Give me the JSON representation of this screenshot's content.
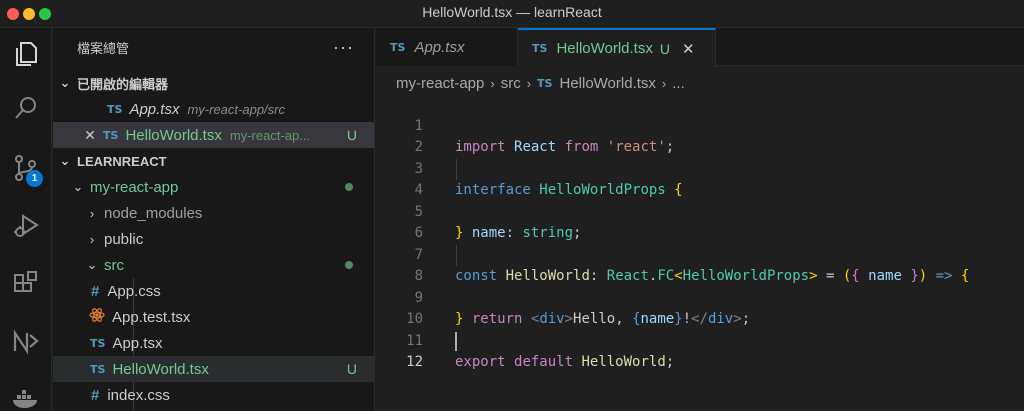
{
  "window": {
    "title": "HelloWorld.tsx — learnReact"
  },
  "activity_bar": {
    "items": [
      {
        "name": "explorer-icon"
      },
      {
        "name": "search-icon"
      },
      {
        "name": "source-control-icon",
        "badge": "1"
      },
      {
        "name": "run-debug-icon"
      },
      {
        "name": "extensions-icon"
      },
      {
        "name": "nx-console-icon"
      },
      {
        "name": "docker-icon"
      }
    ]
  },
  "sidebar": {
    "header": "檔案總管",
    "more": "···",
    "open_editors": {
      "label": "已開啟的編輯器",
      "items": [
        {
          "type": "TS",
          "name": "App.tsx",
          "path": "my-react-app/src"
        },
        {
          "type": "TS",
          "name": "HelloWorld.tsx",
          "path": "my-react-ap...",
          "status": "U"
        }
      ]
    },
    "workspace": {
      "label": "LEARNREACT",
      "tree": [
        {
          "label": "my-react-app"
        },
        {
          "label": "node_modules"
        },
        {
          "label": "public"
        },
        {
          "label": "src"
        },
        {
          "icon": "#",
          "label": "App.css"
        },
        {
          "label": "App.test.tsx"
        },
        {
          "icon": "TS",
          "label": "App.tsx"
        },
        {
          "icon": "TS",
          "label": "HelloWorld.tsx",
          "status": "U"
        },
        {
          "icon": "#",
          "label": "index.css"
        }
      ]
    }
  },
  "editor": {
    "tabs": [
      {
        "type": "TS",
        "label": "App.tsx"
      },
      {
        "type": "TS",
        "label": "HelloWorld.tsx",
        "status": "U",
        "close": "✕"
      }
    ],
    "breadcrumb": [
      "my-react-app",
      "src",
      "HelloWorld.tsx",
      "..."
    ],
    "breadcrumb_type": "TS",
    "line_numbers": [
      "1",
      "2",
      "3",
      "4",
      "5",
      "6",
      "7",
      "8",
      "9",
      "10",
      "11",
      "12"
    ],
    "code": {
      "l1": {
        "kw": "import",
        "id": "React",
        "from": "from",
        "str": "'react'",
        "end": ";"
      },
      "l3": {
        "kw": "interface",
        "name": "HelloWorldProps",
        "brace": "{"
      },
      "l4": {
        "prop": "name",
        "colon": ":",
        "type": "string",
        "end": ";"
      },
      "l5": {
        "brace": "}"
      },
      "l7": {
        "kw": "const",
        "name": "HelloWorld",
        "colon": ":",
        "ns": "React",
        "dot": ".",
        "fc": "FC",
        "lt": "<",
        "generic": "HelloWorldProps",
        "gt": ">",
        "eq": "=",
        "paren_open": "(",
        "brace_open": "{",
        "param": "name",
        "brace_close": "}",
        "paren_close": ")",
        "arrow": "=>",
        "body": "{"
      },
      "l8": {
        "kw": "return",
        "tag_open": "<",
        "tag": "div",
        "tag_close": ">",
        "text": "Hello, ",
        "expr_open": "{",
        "expr": "name",
        "expr_close": "}",
        "text2": "!",
        "end_tag_open": "</",
        "end_tag": "div",
        "end_tag_close": ">",
        "end": ";"
      },
      "l9": {
        "brace": "}"
      },
      "l11": {
        "kw": "export",
        "kw2": "default",
        "name": "HelloWorld",
        "end": ";"
      }
    }
  },
  "colors": {
    "accent": "#0078d4",
    "untracked": "#73c991",
    "ts_icon": "#519aba"
  }
}
